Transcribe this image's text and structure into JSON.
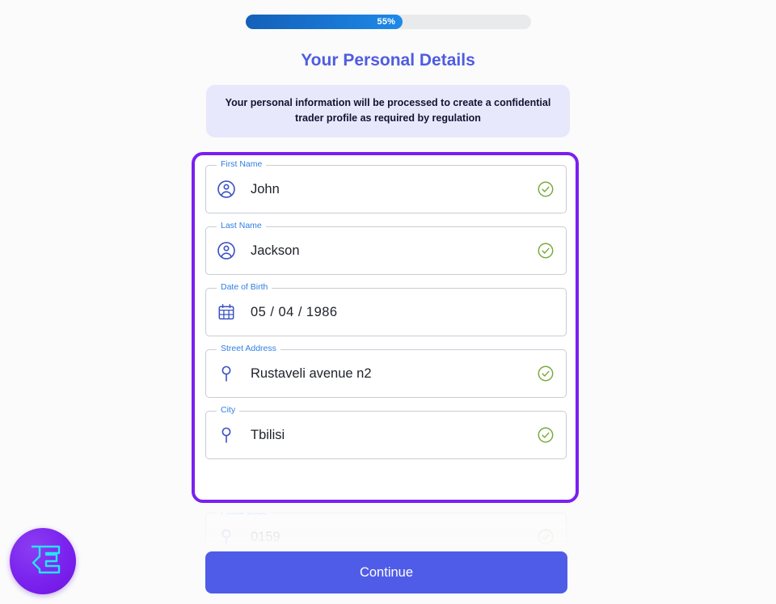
{
  "progress": {
    "percent_label": "55%",
    "value": 55,
    "fill_color": "#1876d2",
    "track_color": "#e9eaec"
  },
  "header": {
    "title": "Your Personal Details",
    "title_color": "#4f5ce0",
    "notice": "Your personal information will be processed to create a confidential trader profile as required by regulation",
    "notice_bg": "#e7e8fb"
  },
  "form": {
    "focus_ring_color": "#7b1ff0",
    "fields": [
      {
        "label": "First Name",
        "value": "John",
        "icon": "person-circle-icon",
        "validated": true
      },
      {
        "label": "Last Name",
        "value": "Jackson",
        "icon": "person-circle-icon",
        "validated": true
      },
      {
        "label": "Date of Birth",
        "icon": "calendar-icon",
        "validated": false,
        "day": "05",
        "month": "04",
        "year": "1986",
        "separator": "/"
      },
      {
        "label": "Street Address",
        "value": "Rustaveli avenue n2",
        "icon": "map-pin-icon",
        "validated": true
      },
      {
        "label": "City",
        "value": "Tbilisi",
        "icon": "map-pin-icon",
        "validated": true
      }
    ],
    "partial_field": {
      "label": "Postal Code",
      "value": "0159",
      "icon": "map-pin-icon",
      "validated": true
    }
  },
  "footer": {
    "continue_label": "Continue",
    "continue_color": "#4f5ce8"
  },
  "logo": {
    "name": "brand-logo-badge",
    "mark": "LC",
    "circle_color": "#7a22ee",
    "mark_color": "#23e5f5"
  }
}
